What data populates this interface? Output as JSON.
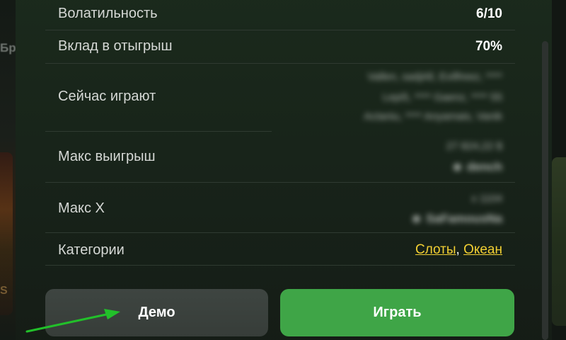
{
  "background": {
    "left_partial_text": "Бр",
    "left_partial_letter": "S"
  },
  "info": {
    "volatility": {
      "label": "Волатильность",
      "value": "6/10"
    },
    "wager": {
      "label": "Вклад в отыгрыш",
      "value": "70%"
    },
    "now_playing": {
      "label": "Сейчас играют",
      "lines": [
        "Vallen, sadjAll, Evilfreez, ****",
        "Lepi5, **** Gaenz, **** 55",
        "Actaniu, **** Anyamais, Vanik"
      ]
    },
    "max_win": {
      "label": "Макс выигрыш",
      "amount": "27 824,22 $",
      "user": "dench"
    },
    "max_x": {
      "label": "Макс X",
      "multiplier": "x 1104",
      "user": "SaFamousNa"
    },
    "categories": {
      "label": "Категории",
      "items": [
        "Слоты",
        "Океан"
      ],
      "separator": ","
    }
  },
  "buttons": {
    "demo": "Демо",
    "play": "Играть"
  },
  "colors": {
    "play_button": "#3fa547",
    "demo_button": "#3b423e",
    "link": "#f2cf33",
    "annotation_arrow": "#22c02a"
  },
  "icons": {
    "user": "user-icon",
    "annotation": "arrow-annotation"
  }
}
